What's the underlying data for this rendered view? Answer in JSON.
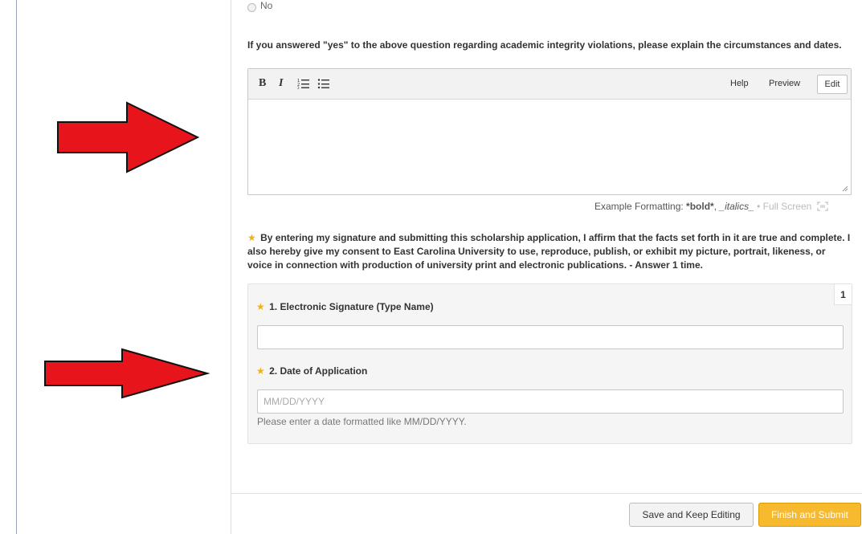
{
  "prior_question": {
    "option_label": "No"
  },
  "integrity_question": {
    "text": "If you answered \"yes\" to the above question regarding academic integrity violations, please explain the circumstances and dates."
  },
  "editor": {
    "toolbar": {
      "bold_label": "B",
      "italic_label": "I",
      "ordered_list_label": "⋮☰",
      "bullet_list_label": "⁝☰",
      "help_label": "Help",
      "preview_label": "Preview",
      "edit_label": "Edit"
    },
    "value": ""
  },
  "formatting": {
    "prefix": "Example Formatting: ",
    "bold_example": "*bold*",
    "separator": ", ",
    "italic_example": "_italics_",
    "dot": " • ",
    "full_screen_label": "Full Screen"
  },
  "consent": {
    "star": "★",
    "text": "By entering my signature and submitting this scholarship application, I affirm that the facts set forth in it are true and complete. I also hereby give my consent to East Carolina University to use, reproduce, publish, or exhibit my picture, portrait, likeness, or voice in connection with production of university print and electronic publications. - Answer 1 time."
  },
  "group": {
    "count": "1",
    "signature": {
      "star": "★",
      "label": "1. Electronic Signature (Type Name)",
      "value": ""
    },
    "date": {
      "star": "★",
      "label": "2. Date of Application",
      "value": "",
      "placeholder": "MM/DD/YYYY",
      "hint": "Please enter a date formatted like MM/DD/YYYY."
    }
  },
  "footer": {
    "save_label": "Save and Keep Editing",
    "submit_label": "Finish and Submit"
  },
  "colors": {
    "arrow_fill": "#e8141b",
    "required_star": "#f0b20d",
    "submit_bg": "#f7b92e"
  },
  "icons": [
    "red-arrow-icon",
    "radio-icon",
    "ordered-list-icon",
    "bullet-list-icon",
    "resize-grip-icon",
    "full-screen-icon"
  ]
}
